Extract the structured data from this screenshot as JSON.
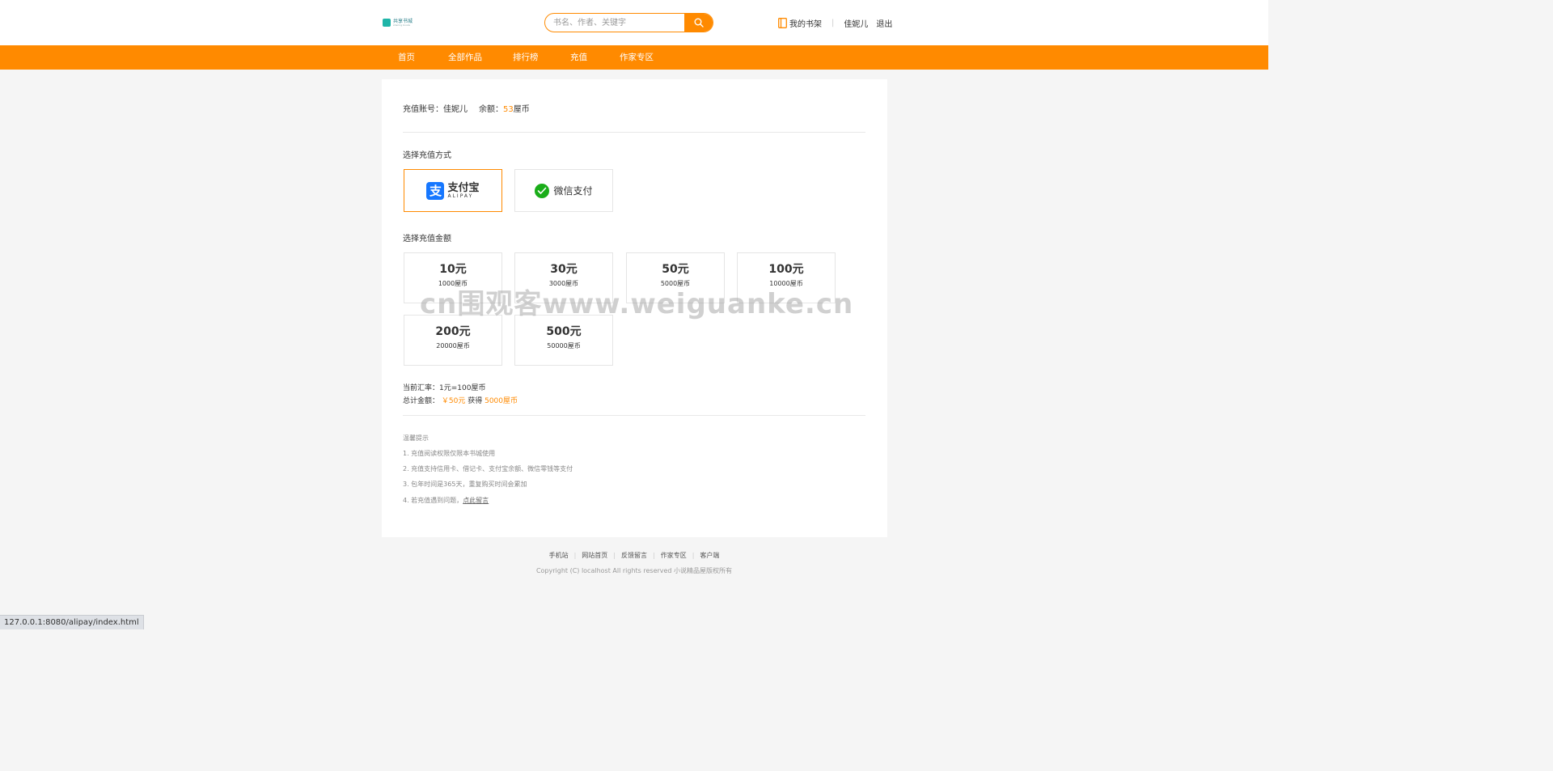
{
  "header": {
    "logo_text": "共享书城",
    "logo_sub": "sharing books",
    "search_placeholder": "书名、作者、关键字",
    "shelf_label": "我的书架",
    "username": "佳妮儿",
    "logout_label": "退出"
  },
  "nav": {
    "items": [
      "首页",
      "全部作品",
      "排行榜",
      "充值",
      "作家专区"
    ]
  },
  "account": {
    "account_label": "充值账号：",
    "account_name": "佳妮儿",
    "balance_label": "余额：",
    "balance_value": "53",
    "balance_unit": "屋币"
  },
  "payment": {
    "title": "选择充值方式",
    "alipay_cn": "支付宝",
    "alipay_en": "ALIPAY",
    "alipay_glyph": "支",
    "wechat_label": "微信支付"
  },
  "amounts": {
    "title": "选择充值金额",
    "options": [
      {
        "yuan": "10元",
        "coins": "1000屋币"
      },
      {
        "yuan": "30元",
        "coins": "3000屋币"
      },
      {
        "yuan": "50元",
        "coins": "5000屋币"
      },
      {
        "yuan": "100元",
        "coins": "10000屋币"
      },
      {
        "yuan": "200元",
        "coins": "20000屋币"
      },
      {
        "yuan": "500元",
        "coins": "50000屋币"
      }
    ]
  },
  "summary": {
    "rate_label": "当前汇率：",
    "rate_value": "1元=100屋币",
    "total_label": "总计金额：",
    "total_value": "￥50元",
    "get_label": "获得",
    "get_value": "5000屋币"
  },
  "tips": {
    "title": "温馨提示",
    "lines": [
      "1. 充值阅读权限仅限本书城使用",
      "2. 充值支持信用卡、借记卡、支付宝余额、微信零钱等支付",
      "3. 包年时间是365天，重复购买时间会累加",
      "4. 若充值遇到问题，"
    ],
    "link_label": "点此留言"
  },
  "footer": {
    "links": [
      "手机站",
      "网站首页",
      "反馈留言",
      "作家专区",
      "客户端"
    ],
    "copyright": "Copyright (C) localhost All rights reserved 小说精品屋版权所有"
  },
  "watermark": "cn围观客www.weiguanke.cn",
  "statusbar": "127.0.0.1:8080/alipay/index.html",
  "colors": {
    "accent": "#ff8a00",
    "alipay_blue": "#1677ff",
    "wechat_green": "#1aad19"
  }
}
